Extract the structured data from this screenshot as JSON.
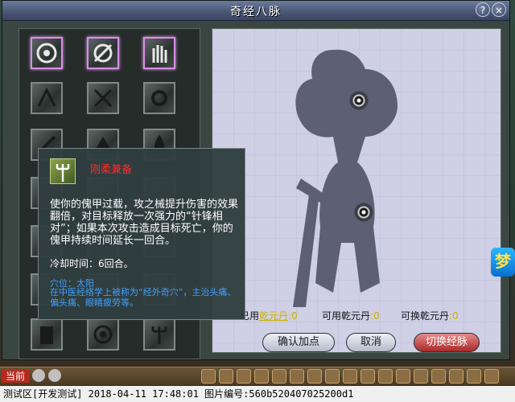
{
  "window": {
    "title": "奇经八脉",
    "help_label": "?",
    "close_label": "×"
  },
  "tooltip": {
    "skill_name": "刚柔兼备",
    "description": "使你的傀甲过载，攻之械提升伤害的效果翻倍，对目标释放一次强力的“针锋相对”；如果本次攻击造成目标死亡，你的傀甲持续时间延长一回合。",
    "cooldown": "冷却时间：6回合。",
    "acupoint_title": "穴位：太阳",
    "acupoint_desc": "在中医经络学上被称为“经外奇穴”，主治头痛、偏头痛、眼睛疲劳等。"
  },
  "stats": {
    "used_label": "已用",
    "used_link": "乾元丹",
    "used_value": ":0",
    "available_label": "可用乾元丹",
    "available_value": ":0",
    "exchangeable_label": "可换乾元丹",
    "exchangeable_value": ":0"
  },
  "buttons": {
    "confirm": "确认加点",
    "cancel": "取消",
    "switch": "切换经脉"
  },
  "side_icon": {
    "label": "梦"
  },
  "bottom_bar": {
    "label": "当前"
  },
  "footer": {
    "text": "测试区[开发测试] 2018-04-11 17:48:01 图片编号:560b520407025200d1"
  },
  "colors": {
    "active_border": "#d98ee8",
    "skill_name": "#ff2a2a",
    "acupoint_text": "#3fa0ff",
    "confirm_red": "#a92a2a"
  }
}
